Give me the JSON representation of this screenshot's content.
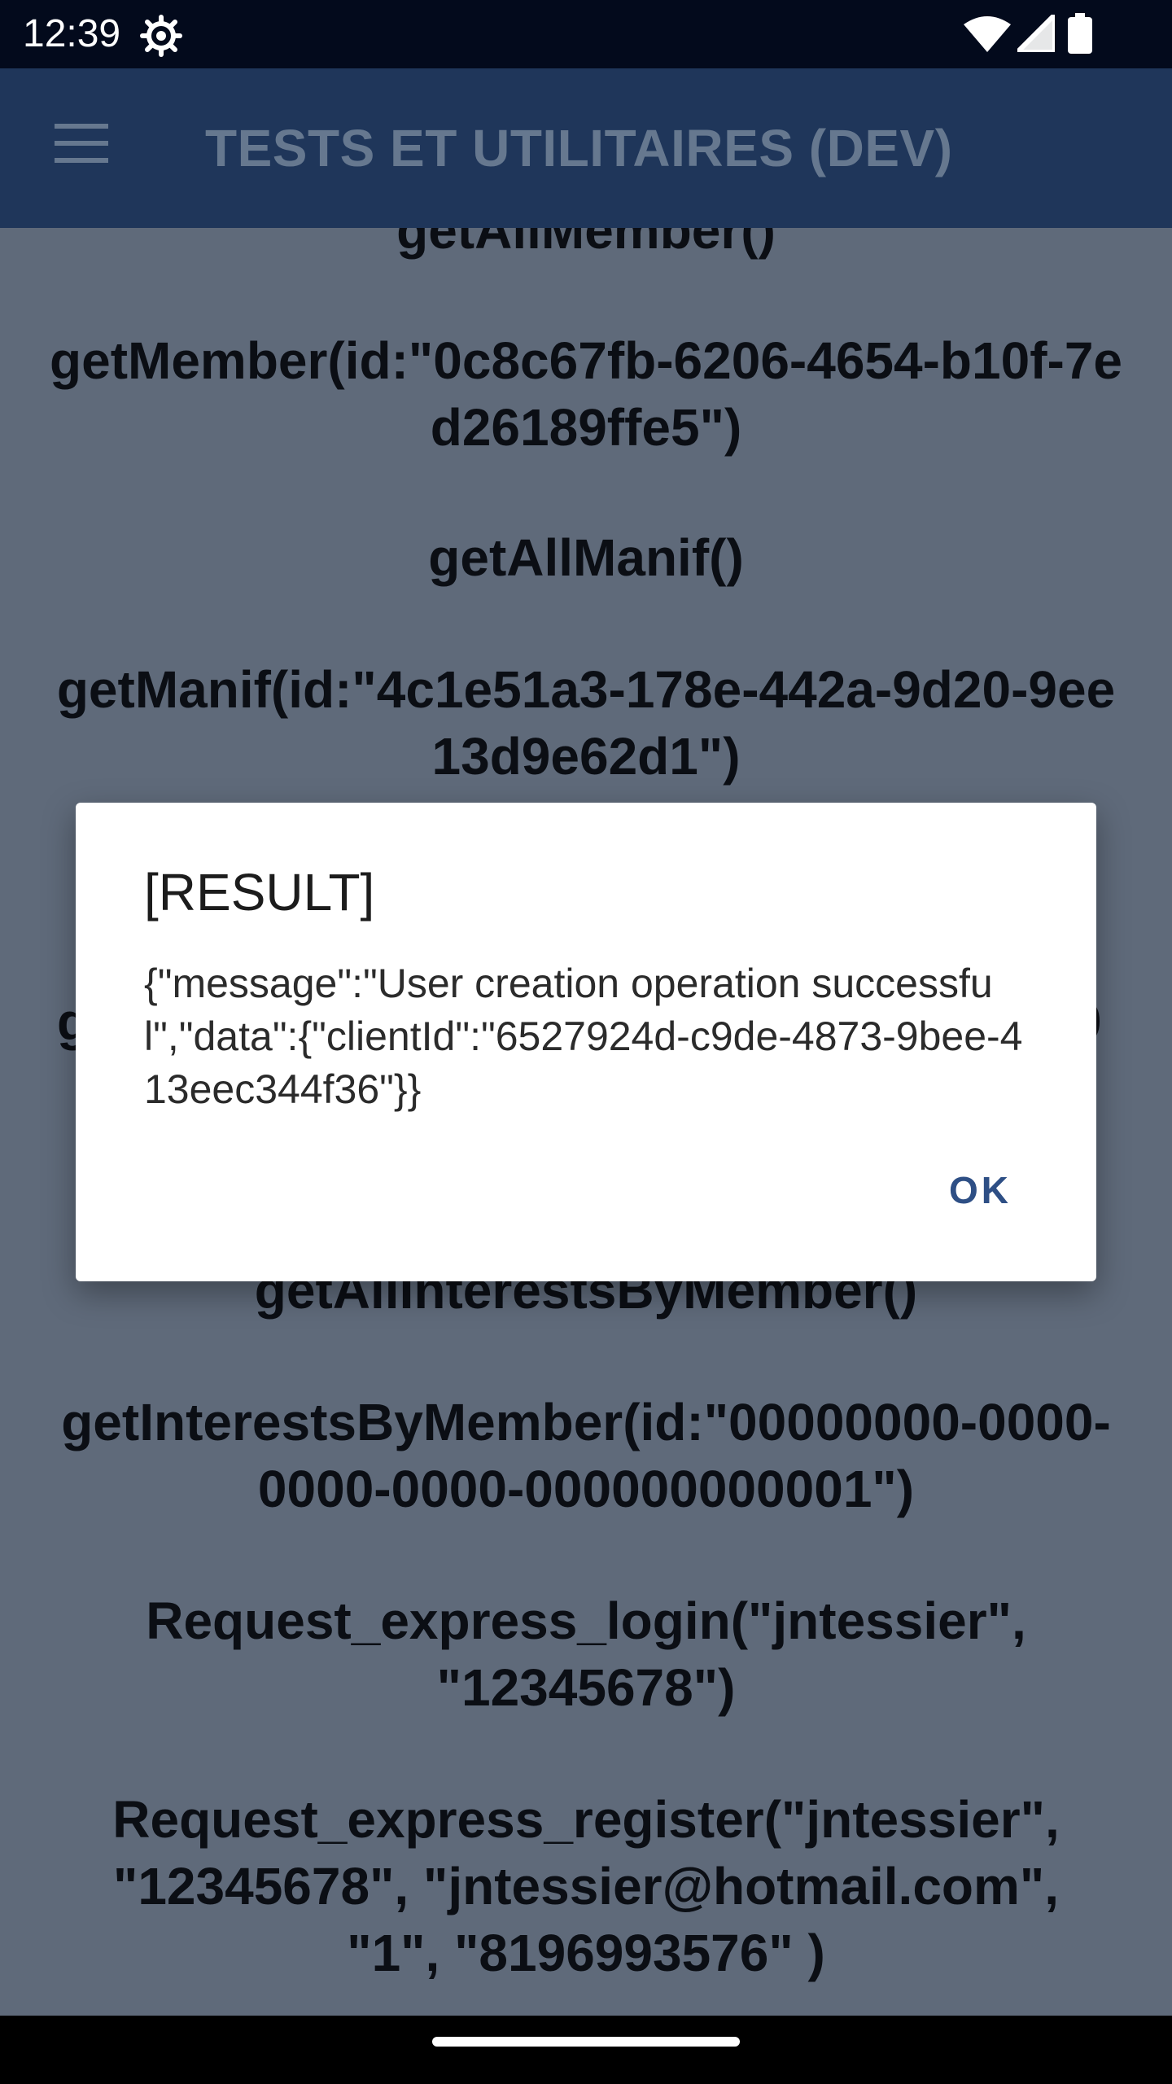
{
  "status_bar": {
    "time": "12:39",
    "icons": [
      "settings-gear-icon",
      "wifi-icon",
      "cell-signal-icon",
      "battery-icon"
    ]
  },
  "app_bar": {
    "title": "TESTS ET UTILITAIRES (DEV)",
    "menu_icon": "hamburger-menu-icon"
  },
  "tests": {
    "items": [
      "getAllMember()",
      "getMember(id:\"0c8c67fb-6206-4654-b10f-7ed26189ffe5\")",
      "getAllManif()",
      "getManif(id:\"4c1e51a3-178e-442a-9d20-9ee13d9e62d1\")",
      "g",
      "0",
      "getAllInterestsByMember()",
      "getInterestsByMember(id:\"00000000-0000-0000-0000-000000000001\")",
      "Request_express_login(\"jntessier\", \"12345678\")",
      "Request_express_register(\"jntessier\", \"12345678\",  \"jntessier@hotmail.com\", \"1\", \"8196993576\"  )"
    ]
  },
  "dialog": {
    "title": "[RESULT]",
    "message": "{\"message\":\"User creation operation successful\",\"data\":{\"clientId\":\"6527924d-c9de-4873-9bee-413eec344f36\"}}",
    "ok_label": "OK"
  },
  "colors": {
    "status_bar": "#030a1c",
    "app_bar": "#1f365a",
    "content_dimmed": "#5f6a7a",
    "dialog_button": "#2e4f85"
  }
}
